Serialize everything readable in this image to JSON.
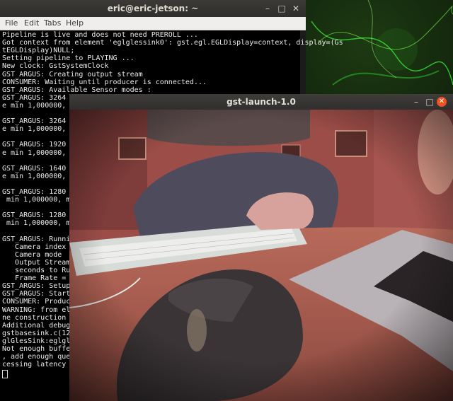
{
  "terminal": {
    "title": "eric@eric-jetson: ~",
    "menu": [
      "File",
      "Edit",
      "Tabs",
      "Help"
    ],
    "lines": [
      "Pipeline is live and does not need PREROLL ...",
      "Got context from element 'eglglessink0': gst.egl.EGLDisplay=context, display=(Gs",
      "tEGLDisplay)NULL;",
      "Setting pipeline to PLAYING ...",
      "New clock: GstSystemClock",
      "GST_ARGUS: Creating output stream",
      "CONSUMER: Waiting until producer is connected...",
      "GST_ARGUS: Available Sensor modes :",
      "GST_ARGUS: 3264 x",
      "e min 1,000000, ma",
      "",
      "GST_ARGUS: 3264 x",
      "e min 1,000000, ma",
      "",
      "GST_ARGUS: 1920 x",
      "e min 1,000000, ma",
      "",
      "GST_ARGUS: 1640 x",
      "e min 1,000000, ma",
      "",
      "GST_ARGUS: 1280 x",
      " min 1,000000, max",
      "",
      "GST_ARGUS: 1280 x",
      " min 1,000000, max",
      "",
      "GST_ARGUS: Running",
      "   Camera index =",
      "   Camera mode  =",
      "   Output Stream W",
      "   seconds to Run",
      "   Frame Rate = 21",
      "GST_ARGUS: Setup C",
      "GST_ARGUS: Startin",
      "CONSUMER: Producer",
      "WARNING: from elem",
      "ne construction is",
      "Additional debug i",
      "gstbasesink.c(1209",
      "glGlesSink:eglgles",
      "Not enough bufferi",
      ", add enough queue",
      "cessing latency to"
    ]
  },
  "camera_window": {
    "title": "gst-launch-1.0"
  },
  "icons": {
    "minimize": "minimize-icon",
    "maximize": "maximize-icon",
    "close": "close-icon"
  },
  "colors": {
    "ubuntu_orange": "#e95420",
    "terminal_bg": "#000000",
    "terminal_fg": "#ececec"
  }
}
